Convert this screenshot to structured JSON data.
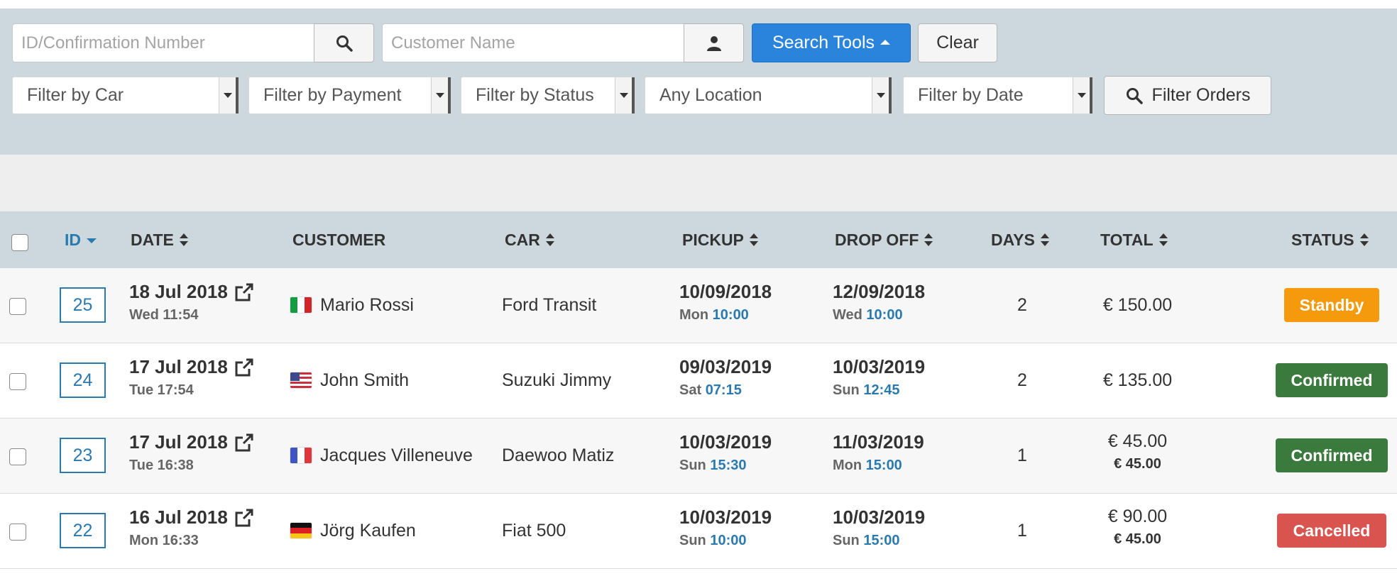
{
  "search": {
    "id_placeholder": "ID/Confirmation Number",
    "customer_placeholder": "Customer Name",
    "search_tools_label": "Search Tools",
    "clear_label": "Clear",
    "filter_orders_label": "Filter Orders"
  },
  "filters": {
    "car": "Filter by Car",
    "payment": "Filter by Payment",
    "status": "Filter by Status",
    "location": "Any Location",
    "date": "Filter by Date"
  },
  "table": {
    "columns": {
      "id": "ID",
      "date": "DATE",
      "customer": "CUSTOMER",
      "car": "CAR",
      "pickup": "PICKUP",
      "dropoff": "DROP OFF",
      "days": "DAYS",
      "total": "TOTAL",
      "status": "STATUS"
    },
    "rows": [
      {
        "id": "25",
        "date": "18 Jul 2018",
        "time": "Wed 11:54",
        "customer": "Mario Rossi",
        "flag": "italy-flag-icon",
        "car": "Ford Transit",
        "pickup_date": "10/09/2018",
        "pickup_day": "Mon",
        "pickup_time": "10:00",
        "dropoff_date": "12/09/2018",
        "dropoff_day": "Wed",
        "dropoff_time": "10:00",
        "days": "2",
        "total": "€ 150.00",
        "total_sub": "",
        "status": "Standby",
        "status_color": "#f59a0c"
      },
      {
        "id": "24",
        "date": "17 Jul 2018",
        "time": "Tue 17:54",
        "customer": "John Smith",
        "flag": "usa-flag-icon",
        "car": "Suzuki Jimmy",
        "pickup_date": "09/03/2019",
        "pickup_day": "Sat",
        "pickup_time": "07:15",
        "dropoff_date": "10/03/2019",
        "dropoff_day": "Sun",
        "dropoff_time": "12:45",
        "days": "2",
        "total": "€ 135.00",
        "total_sub": "",
        "status": "Confirmed",
        "status_color": "#3a7a3d"
      },
      {
        "id": "23",
        "date": "17 Jul 2018",
        "time": "Tue 16:38",
        "customer": "Jacques Villeneuve",
        "flag": "france-flag-icon",
        "car": "Daewoo Matiz",
        "pickup_date": "10/03/2019",
        "pickup_day": "Sun",
        "pickup_time": "15:30",
        "dropoff_date": "11/03/2019",
        "dropoff_day": "Mon",
        "dropoff_time": "15:00",
        "days": "1",
        "total": "€ 45.00",
        "total_sub": "€ 45.00",
        "status": "Confirmed",
        "status_color": "#3a7a3d"
      },
      {
        "id": "22",
        "date": "16 Jul 2018",
        "time": "Mon 16:33",
        "customer": "Jörg Kaufen",
        "flag": "germany-flag-icon",
        "car": "Fiat 500",
        "pickup_date": "10/03/2019",
        "pickup_day": "Sun",
        "pickup_time": "10:00",
        "dropoff_date": "10/03/2019",
        "dropoff_day": "Sun",
        "dropoff_time": "15:00",
        "days": "1",
        "total": "€ 90.00",
        "total_sub": "€ 45.00",
        "status": "Cancelled",
        "status_color": "#d9534f"
      }
    ]
  },
  "colors": {
    "primary": "#2a84dc",
    "link": "#2a7ab0",
    "panel": "#cdd8de"
  }
}
